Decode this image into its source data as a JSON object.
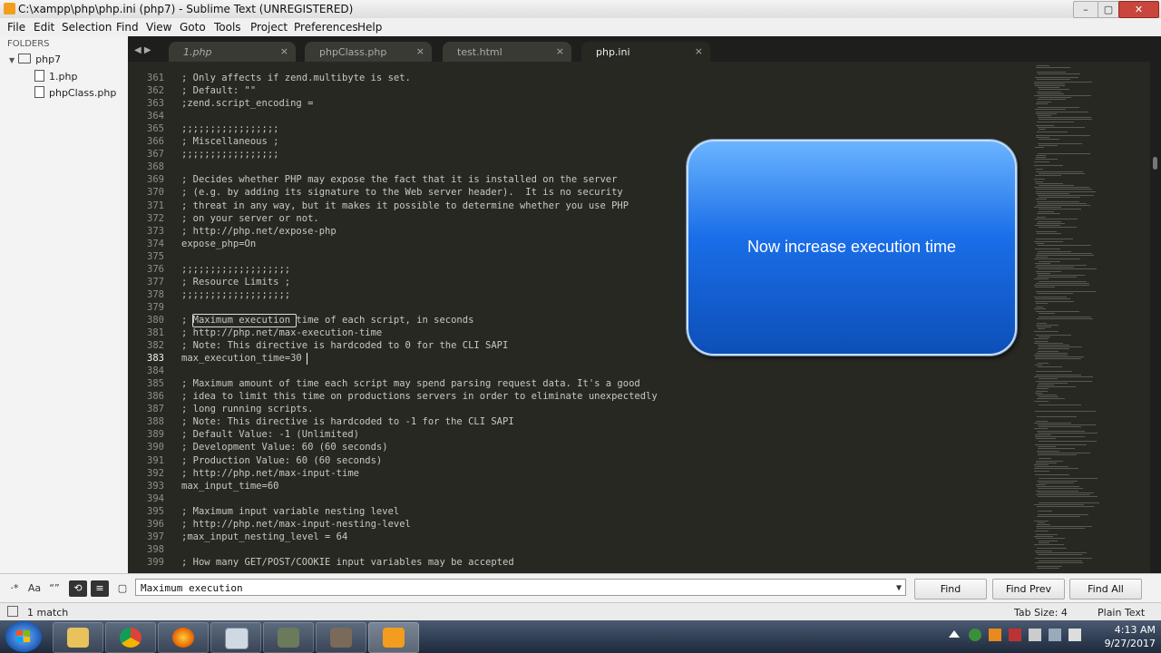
{
  "window": {
    "title": "C:\\xampp\\php\\php.ini (php7) - Sublime Text (UNREGISTERED)",
    "min": "–",
    "max": "▢",
    "close": "✕"
  },
  "menu": [
    "File",
    "Edit",
    "Selection",
    "Find",
    "View",
    "Goto",
    "Tools",
    "Project",
    "Preferences",
    "Help"
  ],
  "sidebar": {
    "header": "FOLDERS",
    "folder": "php7",
    "files": [
      "1.php",
      "phpClass.php"
    ]
  },
  "tabs": [
    {
      "label": "1.php",
      "close": "×"
    },
    {
      "label": "phpClass.php",
      "close": "×"
    },
    {
      "label": "test.html",
      "close": "×"
    },
    {
      "label": "php.ini",
      "close": "×"
    }
  ],
  "tab_nav": "◀ ▶",
  "code_lines": [
    {
      "n": "361",
      "t": "; Only affects if zend.multibyte is set."
    },
    {
      "n": "362",
      "t": "; Default: \"\""
    },
    {
      "n": "363",
      "t": ";zend.script_encoding ="
    },
    {
      "n": "364",
      "t": ""
    },
    {
      "n": "365",
      "t": ";;;;;;;;;;;;;;;;;"
    },
    {
      "n": "366",
      "t": "; Miscellaneous ;"
    },
    {
      "n": "367",
      "t": ";;;;;;;;;;;;;;;;;"
    },
    {
      "n": "368",
      "t": ""
    },
    {
      "n": "369",
      "t": "; Decides whether PHP may expose the fact that it is installed on the server"
    },
    {
      "n": "370",
      "t": "; (e.g. by adding its signature to the Web server header).  It is no security"
    },
    {
      "n": "371",
      "t": "; threat in any way, but it makes it possible to determine whether you use PHP"
    },
    {
      "n": "372",
      "t": "; on your server or not."
    },
    {
      "n": "373",
      "t": "; http://php.net/expose-php"
    },
    {
      "n": "374",
      "t": "expose_php=On"
    },
    {
      "n": "375",
      "t": ""
    },
    {
      "n": "376",
      "t": ";;;;;;;;;;;;;;;;;;;"
    },
    {
      "n": "377",
      "t": "; Resource Limits ;"
    },
    {
      "n": "378",
      "t": ";;;;;;;;;;;;;;;;;;;"
    },
    {
      "n": "379",
      "t": ""
    },
    {
      "n": "380",
      "t": "; Maximum execution time of each script, in seconds"
    },
    {
      "n": "381",
      "t": "; http://php.net/max-execution-time"
    },
    {
      "n": "382",
      "t": "; Note: This directive is hardcoded to 0 for the CLI SAPI"
    },
    {
      "n": "383",
      "t": "max_execution_time=30"
    },
    {
      "n": "384",
      "t": ""
    },
    {
      "n": "385",
      "t": "; Maximum amount of time each script may spend parsing request data. It's a good"
    },
    {
      "n": "386",
      "t": "; idea to limit this time on productions servers in order to eliminate unexpectedly"
    },
    {
      "n": "387",
      "t": "; long running scripts."
    },
    {
      "n": "388",
      "t": "; Note: This directive is hardcoded to -1 for the CLI SAPI"
    },
    {
      "n": "389",
      "t": "; Default Value: -1 (Unlimited)"
    },
    {
      "n": "390",
      "t": "; Development Value: 60 (60 seconds)"
    },
    {
      "n": "391",
      "t": "; Production Value: 60 (60 seconds)"
    },
    {
      "n": "392",
      "t": "; http://php.net/max-input-time"
    },
    {
      "n": "393",
      "t": "max_input_time=60"
    },
    {
      "n": "394",
      "t": ""
    },
    {
      "n": "395",
      "t": "; Maximum input variable nesting level"
    },
    {
      "n": "396",
      "t": "; http://php.net/max-input-nesting-level"
    },
    {
      "n": "397",
      "t": ";max_input_nesting_level = 64"
    },
    {
      "n": "398",
      "t": ""
    },
    {
      "n": "399",
      "t": "; How many GET/POST/COOKIE input variables may be accepted"
    }
  ],
  "current_line": "383",
  "callout": {
    "text": "Now increase execution time"
  },
  "find": {
    "value": "Maximum execution",
    "options": [
      "·*",
      "Aa",
      "“”",
      "⟲",
      "≡",
      "▢"
    ],
    "buttons": {
      "find": "Find",
      "find_prev": "Find Prev",
      "find_all": "Find All"
    },
    "dropdown": "▼"
  },
  "status": {
    "matches": "1 match",
    "tab_size": "Tab Size: 4",
    "syntax": "Plain Text"
  },
  "taskbar": {
    "time": "4:13 AM",
    "date": "9/27/2017"
  },
  "colors": {
    "editor_bg": "#272822",
    "callout": "#1a6ee8"
  }
}
